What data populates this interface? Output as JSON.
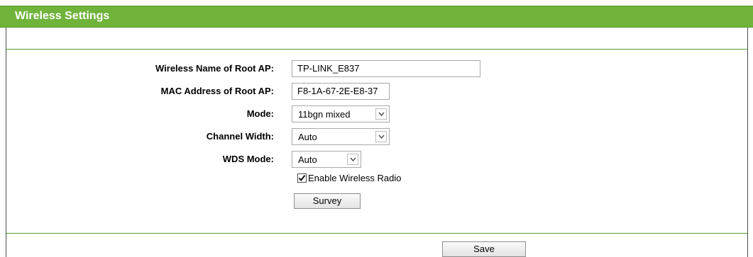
{
  "header": {
    "title": "Wireless Settings"
  },
  "form": {
    "root_ap_name": {
      "label": "Wireless Name of Root AP:",
      "value": "TP-LINK_E837"
    },
    "root_ap_mac": {
      "label": "MAC Address of Root AP:",
      "value": "F8-1A-67-2E-E8-37"
    },
    "mode": {
      "label": "Mode:",
      "value": "11bgn mixed"
    },
    "channel_width": {
      "label": "Channel Width:",
      "value": "Auto"
    },
    "wds_mode": {
      "label": "WDS Mode:",
      "value": "Auto"
    },
    "enable_radio": {
      "label": "Enable Wireless Radio",
      "checked": true
    },
    "survey_label": "Survey"
  },
  "footer": {
    "save_label": "Save"
  },
  "colors": {
    "header": "#6fb33a",
    "rule": "#5aa132"
  },
  "icons": {
    "dropdown": "chevron-down-icon",
    "check": "checkmark-icon"
  }
}
